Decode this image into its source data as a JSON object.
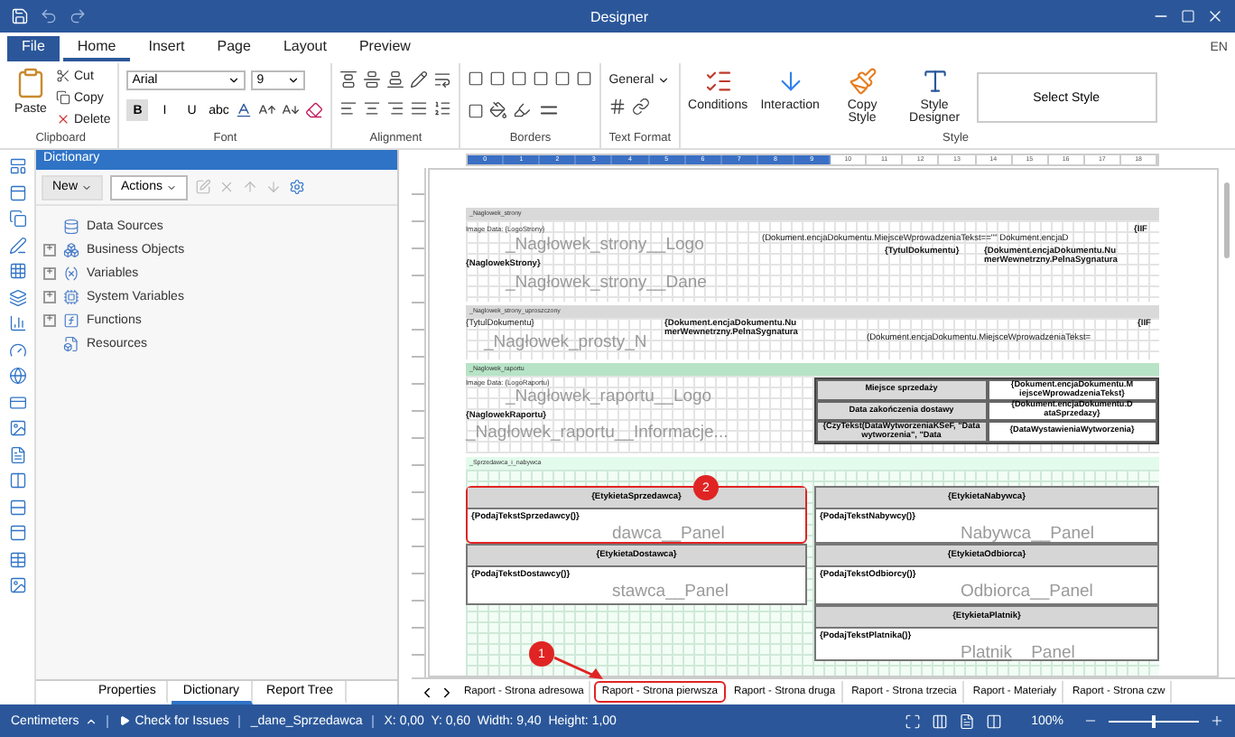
{
  "window": {
    "title": "Designer"
  },
  "menu_tabs": [
    {
      "label": "File",
      "kind": "file",
      "selected": false
    },
    {
      "label": "Home",
      "kind": "tab",
      "selected": true
    },
    {
      "label": "Insert",
      "kind": "tab",
      "selected": false
    },
    {
      "label": "Page",
      "kind": "tab",
      "selected": false
    },
    {
      "label": "Layout",
      "kind": "tab",
      "selected": false
    },
    {
      "label": "Preview",
      "kind": "tab",
      "selected": false
    }
  ],
  "language": "EN",
  "ribbon": {
    "clipboard": {
      "paste": "Paste",
      "cut": "Cut",
      "copy": "Copy",
      "delete": "Delete",
      "label": "Clipboard"
    },
    "font": {
      "name": "Arial",
      "size": "9",
      "label": "Font",
      "styles": [
        {
          "label": "B",
          "selected": true
        },
        {
          "label": "I",
          "selected": false
        },
        {
          "label": "U",
          "selected": false
        },
        {
          "label": "abc",
          "selected": false
        }
      ]
    },
    "alignment": {
      "label": "Alignment"
    },
    "borders": {
      "label": "Borders"
    },
    "text_format": {
      "format": "General",
      "label": "Text Format"
    },
    "style": {
      "buttons": [
        "Conditions",
        "Interaction",
        "Copy Style",
        "Style Designer"
      ],
      "select": "Select Style",
      "label": "Style"
    }
  },
  "dictionary": {
    "title": "Dictionary",
    "toolbar": [
      "New",
      "Actions"
    ],
    "items": [
      {
        "label": "Data Sources",
        "kind": "leaf"
      },
      {
        "label": "Business Objects",
        "kind": "group",
        "expander": "+"
      },
      {
        "label": "Variables",
        "kind": "group",
        "expander": "+"
      },
      {
        "label": "System Variables",
        "kind": "group",
        "expander": "+"
      },
      {
        "label": "Functions",
        "kind": "group",
        "expander": "+"
      },
      {
        "label": "Resources",
        "kind": "leaf"
      }
    ]
  },
  "panel_tabs": [
    {
      "label": "Properties",
      "selected": false
    },
    {
      "label": "Dictionary",
      "selected": true
    },
    {
      "label": "Report Tree",
      "selected": false
    }
  ],
  "ruler": [
    {
      "label": "0",
      "selected": true
    },
    {
      "label": "1",
      "selected": true
    },
    {
      "label": "2",
      "selected": true
    },
    {
      "label": "3",
      "selected": true
    },
    {
      "label": "4",
      "selected": true
    },
    {
      "label": "5",
      "selected": true
    },
    {
      "label": "6",
      "selected": true
    },
    {
      "label": "7",
      "selected": true
    },
    {
      "label": "8",
      "selected": true
    },
    {
      "label": "9",
      "selected": true
    },
    {
      "label": "10",
      "selected": false
    },
    {
      "label": "11",
      "selected": false
    },
    {
      "label": "12",
      "selected": false
    },
    {
      "label": "13",
      "selected": false
    },
    {
      "label": "14",
      "selected": false
    },
    {
      "label": "15",
      "selected": false
    },
    {
      "label": "16",
      "selected": false
    },
    {
      "label": "17",
      "selected": false
    },
    {
      "label": "18",
      "selected": false
    }
  ],
  "bands": [
    {
      "name": "_Naglowek_strony",
      "kind": "header",
      "components": [
        {
          "kind": "image",
          "text": "Image Data: {LogoStrony}"
        },
        {
          "kind": "ghost",
          "text": "_Nagłowek_strony__Logo"
        },
        {
          "kind": "field",
          "text": "{NaglowekStrony}"
        },
        {
          "kind": "ghost",
          "text": "_Nagłowek_strony__Dane"
        },
        {
          "kind": "field",
          "text": "{IIF"
        },
        {
          "kind": "text",
          "text": "(Dokument.encjaDokumentu.MiejsceWprowadzeniaTekst==\"\" Dokument.encjaD"
        },
        {
          "kind": "field",
          "text": "{TytulDokumentu}"
        },
        {
          "kind": "field",
          "text": "{Dokument.encjaDokumentu.Nu merWewnetrzny.PelnaSygnatura"
        }
      ]
    },
    {
      "name": "_Naglowek_strony_uproszczony",
      "kind": "header",
      "components": [
        {
          "kind": "text",
          "text": "{TytulDokumentu}"
        },
        {
          "kind": "ghost",
          "text": "_Nagłowek_prosty_N"
        },
        {
          "kind": "field",
          "text": "{Dokument.encjaDokumentu.Nu merWewnetrzny.PelnaSygnatura"
        },
        {
          "kind": "field",
          "text": "{IIF"
        },
        {
          "kind": "text",
          "text": "(Dokument.encjaDokumentu.MiejsceWprowadzeniaTekst="
        }
      ]
    },
    {
      "name": "_Naglowek_raportu",
      "kind": "report",
      "components": [
        {
          "kind": "image",
          "text": "Image Data: {LogoRaportu}"
        },
        {
          "kind": "ghost",
          "text": "_Nagłowek_raportu__Logo"
        },
        {
          "kind": "field",
          "text": "{NaglowekRaportu}"
        },
        {
          "kind": "ghost",
          "text": "_Nagłowek_raportu__Informacje..."
        }
      ],
      "table": [
        {
          "label": "Miejsce sprzedaży",
          "value": "{Dokument.encjaDokumentu.M iejsceWprowadzeniaTekst}"
        },
        {
          "label": "Data zakończenia dostawy",
          "value": "{Dokument.encjaDokumentu.D ataSprzedazy}"
        },
        {
          "label": "{CzyTekst(DataWytworzeniaKSeF, \"Data wytworzenia\", \"Data",
          "value": "{DataWystawieniaWytworzenia}"
        }
      ]
    },
    {
      "name": "_Sprzedawca_i_nabywca",
      "kind": "data",
      "panels": [
        {
          "title": "{EtykietaSprzedawca}",
          "body": "{PodajTekstSprzedawcy()}",
          "ghost": "dawca__Panel",
          "selected": true
        },
        {
          "title": "{EtykietaDostawca}",
          "body": "{PodajTekstDostawcy()}",
          "ghost": "stawca__Panel",
          "selected": false
        },
        {
          "title": "{EtykietaNabywca}",
          "body": "{PodajTekstNabywcy()}",
          "ghost": "Nabywca__Panel",
          "selected": false
        },
        {
          "title": "{EtykietaOdbiorca}",
          "body": "{PodajTekstOdbiorcy()}",
          "ghost": "Odbiorca__Panel",
          "selected": false
        },
        {
          "title": "{EtykietaPlatnik}",
          "body": "{PodajTekstPlatnika()}",
          "ghost": "Platnik__Panel",
          "selected": false
        }
      ]
    }
  ],
  "callouts": [
    "1",
    "2"
  ],
  "page_tabs": [
    {
      "label": "Raport - Strona adresowa",
      "selected": false
    },
    {
      "label": "Raport - Strona pierwsza",
      "selected": true
    },
    {
      "label": "Raport - Strona druga",
      "selected": false
    },
    {
      "label": "Raport - Strona trzecia",
      "selected": false
    },
    {
      "label": "Raport - Materiały",
      "selected": false
    },
    {
      "label": "Raport - Strona czw",
      "selected": false
    }
  ],
  "status_bar": {
    "unit": "Centimeters",
    "check": "Check for Issues",
    "component": "_dane_Sprzedawca",
    "position": "X: 0,00  Y: 0,60  Width: 9,40  Height: 1,00",
    "zoom": "100%",
    "zoom_slider": {
      "level": 0.5
    }
  }
}
